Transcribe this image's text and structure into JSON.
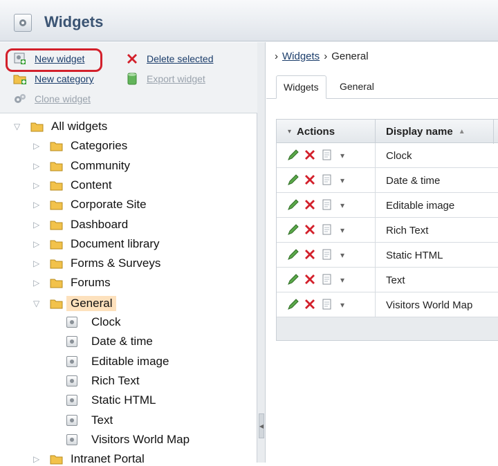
{
  "window": {
    "title": "Widgets",
    "icon": "widgets-gear-icon"
  },
  "left": {
    "actions": {
      "new_widget": "New widget",
      "delete_selected": "Delete selected",
      "new_category": "New category",
      "export_widget": "Export widget",
      "clone_widget": "Clone widget"
    },
    "tree": {
      "root": "All widgets",
      "categories": [
        "Categories",
        "Community",
        "Content",
        "Corporate Site",
        "Dashboard",
        "Document library",
        "Forms & Surveys",
        "Forums"
      ],
      "selected_category": "General",
      "widgets": [
        "Clock",
        "Date & time",
        "Editable image",
        "Rich Text",
        "Static HTML",
        "Text",
        "Visitors World Map"
      ],
      "after": "Intranet Portal"
    }
  },
  "right": {
    "breadcrumb": {
      "root": "Widgets",
      "current": "General"
    },
    "tabs": [
      "Widgets",
      "General"
    ],
    "grid": {
      "headers": {
        "actions": "Actions",
        "display_name": "Display name"
      },
      "rows": [
        "Clock",
        "Date & time",
        "Editable image",
        "Rich Text",
        "Static HTML",
        "Text",
        "Visitors World Map"
      ]
    }
  },
  "colors": {
    "accent_red": "#d3202b",
    "title_blue": "#3b5473",
    "selected_bg": "#fde1bd"
  }
}
